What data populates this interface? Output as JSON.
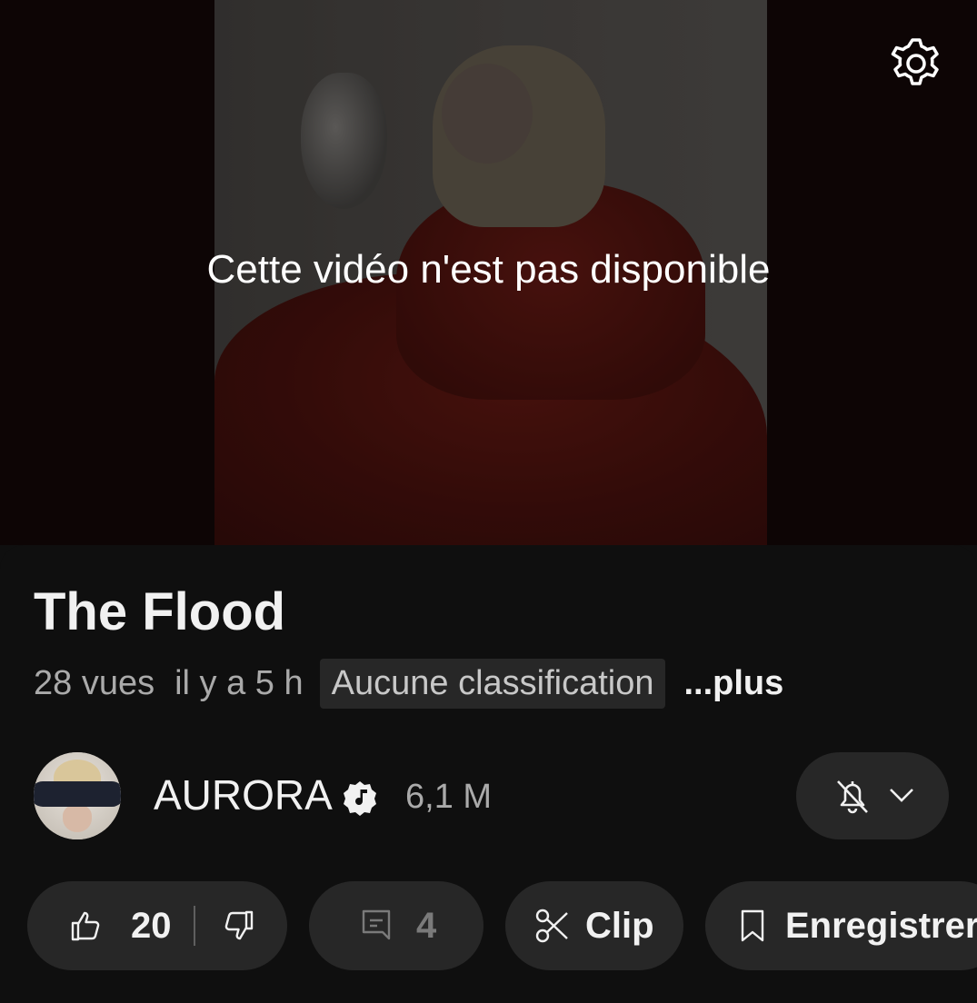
{
  "player": {
    "unavailable_message": "Cette vidéo n'est pas disponible",
    "settings_icon": "gear-icon"
  },
  "video": {
    "title": "The Flood",
    "views": "28 vues",
    "age": "il y a 5 h",
    "rating_badge": "Aucune classification",
    "more_link": "...plus"
  },
  "channel": {
    "name": "AURORA",
    "badge_icon": "music-note-verified-icon",
    "subscribers": "6,1 M",
    "notification_icon": "bell-off-icon",
    "dropdown_icon": "chevron-down-icon"
  },
  "actions": {
    "like_count": "20",
    "like_icon": "thumbs-up-icon",
    "dislike_icon": "thumbs-down-icon",
    "comments_count": "4",
    "comments_icon": "comment-icon",
    "clip_label": "Clip",
    "clip_icon": "scissors-icon",
    "save_label": "Enregistrer",
    "save_icon": "bookmark-icon"
  },
  "colors": {
    "background": "#0f0f0f",
    "pill_background": "#272727",
    "primary_text": "#f1f1f1",
    "secondary_text": "#aaaaaa"
  }
}
